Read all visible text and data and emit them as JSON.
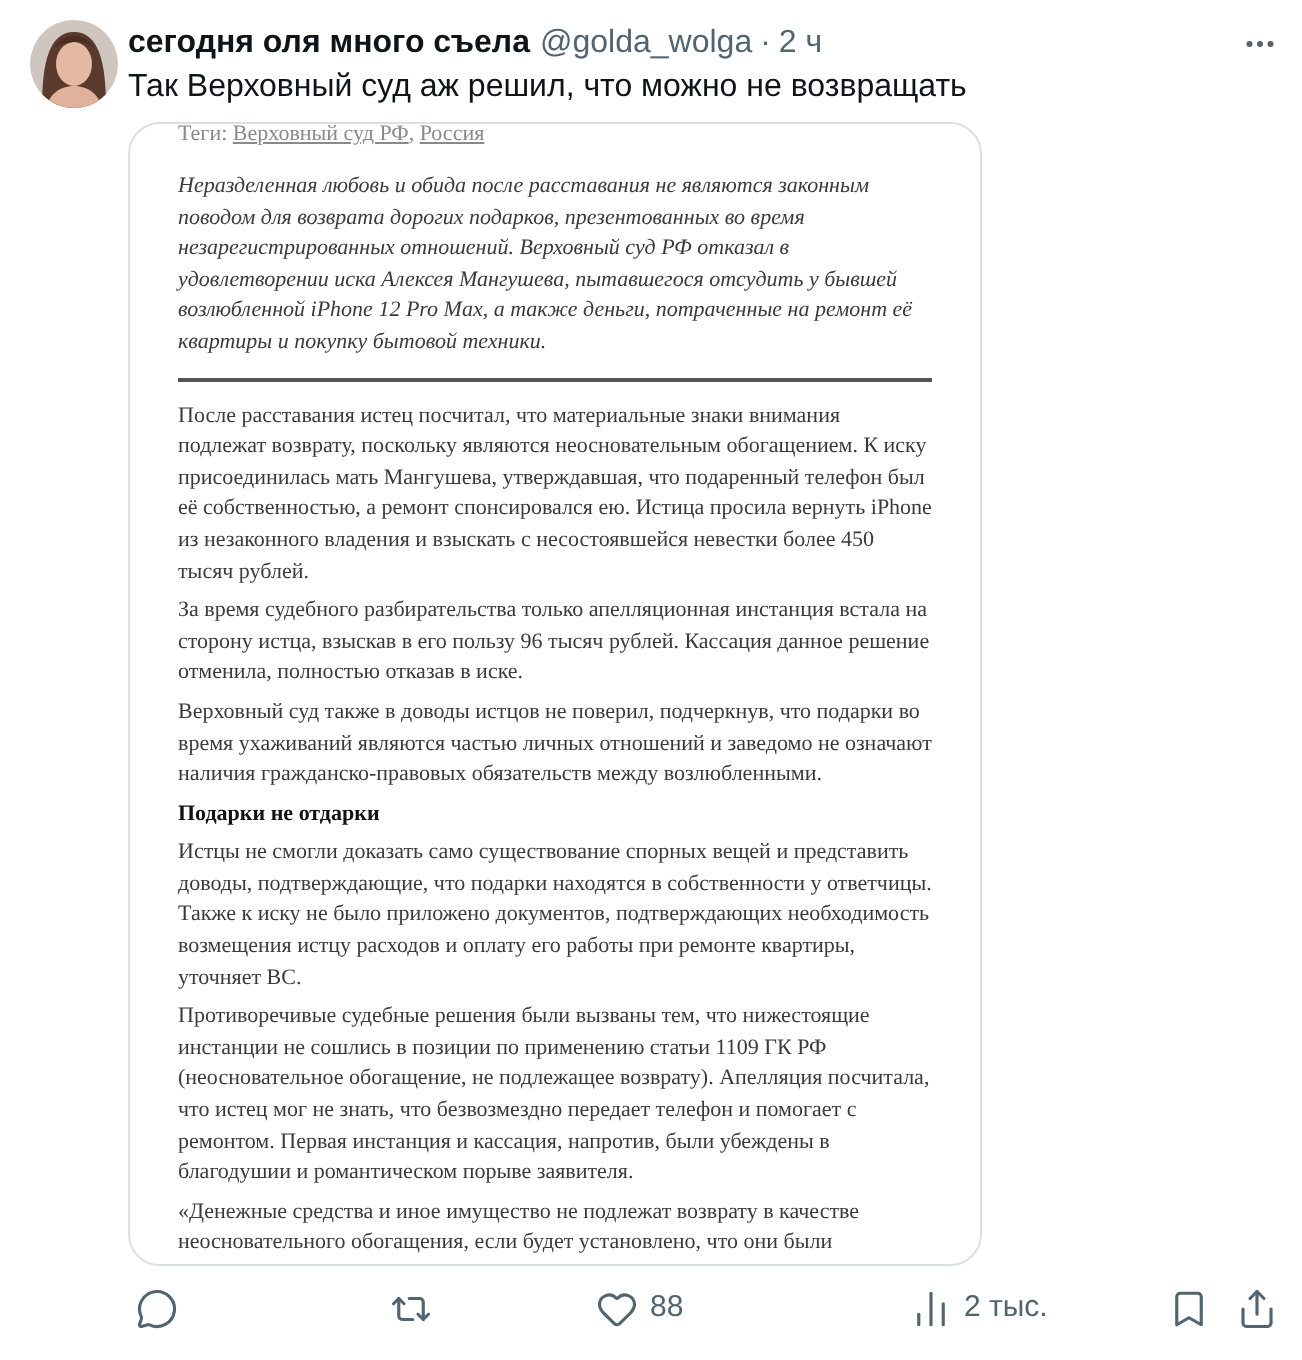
{
  "post": {
    "author": "сегодня оля много съела",
    "handle": "@golda_wolga",
    "separator": "·",
    "time": "2 ч",
    "text": "Так Верховный суд аж решил, что можно не возвращать"
  },
  "article": {
    "tags_label": "Теги:",
    "tags": [
      "Верховный суд РФ",
      "Россия"
    ],
    "tags_separator": ",",
    "lead": "Неразделенная любовь и обида после расставания не являются законным поводом для возврата дорогих подарков, презентованных во время незарегистрированных отношений. Верховный суд РФ отказал в удовлетворении иска Алексея Мангушева, пытавшегося отсудить у бывшей возлюбленной iPhone 12 Pro Max, а также деньги, потраченные на ремонт её квартиры и покупку бытовой техники.",
    "blocks": [
      {
        "kind": "paragraph",
        "text": "После расставания истец посчитал, что материальные знаки внимания подлежат возврату, поскольку являются неосновательным обогащением. К иску присоединилась мать Мангушева, утверждавшая, что подаренный телефон был её собственностью, а ремонт спонсировался ею. Истица просила вернуть iPhone из незаконного владения и взыскать с несостоявшейся невестки более 450 тысяч рублей."
      },
      {
        "kind": "paragraph",
        "text": "За время судебного разбирательства только апелляционная инстанция встала на сторону истца, взыскав в его пользу 96 тысяч рублей. Кассация данное решение отменила, полностью отказав в иске."
      },
      {
        "kind": "paragraph",
        "text": "Верховный суд также в доводы истцов не поверил, подчеркнув, что подарки во время ухаживаний являются частью личных отношений и заведомо не означают наличия гражданско-правовых обязательств между возлюбленными."
      },
      {
        "kind": "heading",
        "text": "Подарки не отдарки"
      },
      {
        "kind": "paragraph",
        "text": "Истцы не смогли доказать само существование спорных вещей и представить доводы, подтверждающие, что подарки находятся в собственности у ответчицы. Также к иску не было приложено документов, подтверждающих необходимость возмещения истцу расходов и оплату его работы при ремонте квартиры, уточняет ВС."
      },
      {
        "kind": "paragraph",
        "text": "Противоречивые судебные решения были вызваны тем, что нижестоящие инстанции не сошлись в позиции по применению статьи 1109 ГК РФ (неосновательное обогащение, не подлежащее возврату). Апелляция посчитала, что истец мог не знать, что безвозмездно передает телефон и помогает с ремонтом. Первая инстанция и кассация, напротив, были убеждены в благодушии и романтическом порыве заявителя."
      },
      {
        "kind": "paragraph",
        "text": "«Денежные средства и иное имущество не подлежат возврату в качестве неосновательного обогащения, если будет установлено, что они были"
      }
    ]
  },
  "actions": [
    {
      "kind": "reply"
    },
    {
      "kind": "repost"
    },
    {
      "kind": "like",
      "count": "88"
    },
    {
      "kind": "views",
      "count": "2 тыс."
    },
    {
      "kind": "bookmark"
    },
    {
      "kind": "share"
    }
  ]
}
